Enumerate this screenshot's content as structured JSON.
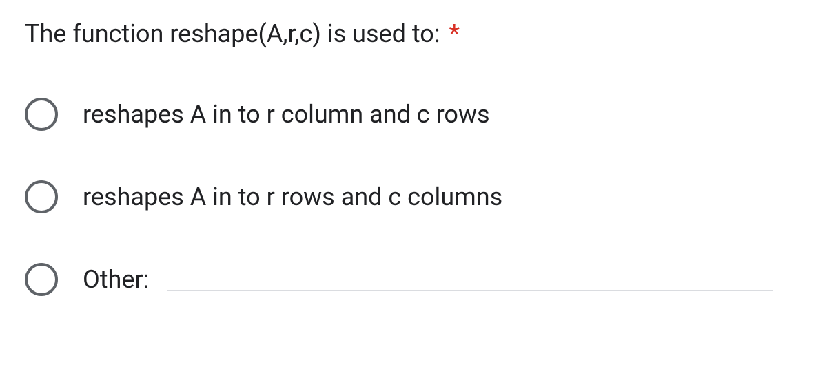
{
  "question": {
    "title": "The function reshape(A,r,c)  is used to:",
    "required_marker": "*"
  },
  "options": [
    {
      "label": "reshapes A in to r column and c rows"
    },
    {
      "label": "reshapes A in to r rows and c columns"
    }
  ],
  "other": {
    "label": "Other:"
  }
}
